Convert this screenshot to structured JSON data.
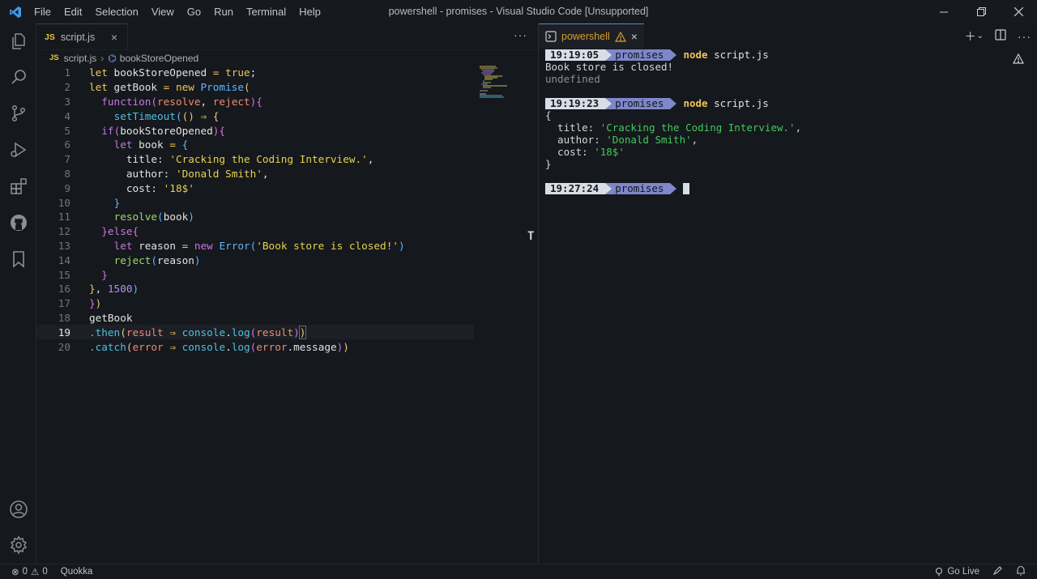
{
  "window": {
    "title": "powershell - promises - Visual Studio Code [Unsupported]",
    "menu": [
      "File",
      "Edit",
      "Selection",
      "View",
      "Go",
      "Run",
      "Terminal",
      "Help"
    ]
  },
  "editor": {
    "tab": {
      "icon": "JS",
      "label": "script.js"
    },
    "breadcrumb": {
      "file": "script.js",
      "symbol": "bookStoreOpened"
    },
    "current_line": 19
  },
  "terminal": {
    "tab_label": "powershell",
    "runs": [
      {
        "time": "19:19:05",
        "dir": "promises",
        "cmd": "node",
        "arg": "script.js"
      },
      {
        "time": "19:19:23",
        "dir": "promises",
        "cmd": "node",
        "arg": "script.js"
      },
      {
        "time": "19:27:24",
        "dir": "promises"
      }
    ],
    "output1": [
      "Book store is closed!",
      "undefined"
    ],
    "output2": {
      "open": "{",
      "title_key": "  title: ",
      "title_val": "'Cracking the Coding Interview.'",
      "title_end": ",",
      "author_key": "  author: ",
      "author_val": "'Donald Smith'",
      "author_end": ",",
      "cost_key": "  cost: ",
      "cost_val": "'18$'",
      "close": "}"
    }
  },
  "status": {
    "errors": "0",
    "warnings": "0",
    "quokka": "Quokka",
    "golive": "Go Live"
  },
  "colors": {
    "accent": "#3e8fe0",
    "prompt_time_bg": "#d9dde6",
    "prompt_dir_bg": "#7d87c9",
    "terminal_string": "#44c85c"
  }
}
